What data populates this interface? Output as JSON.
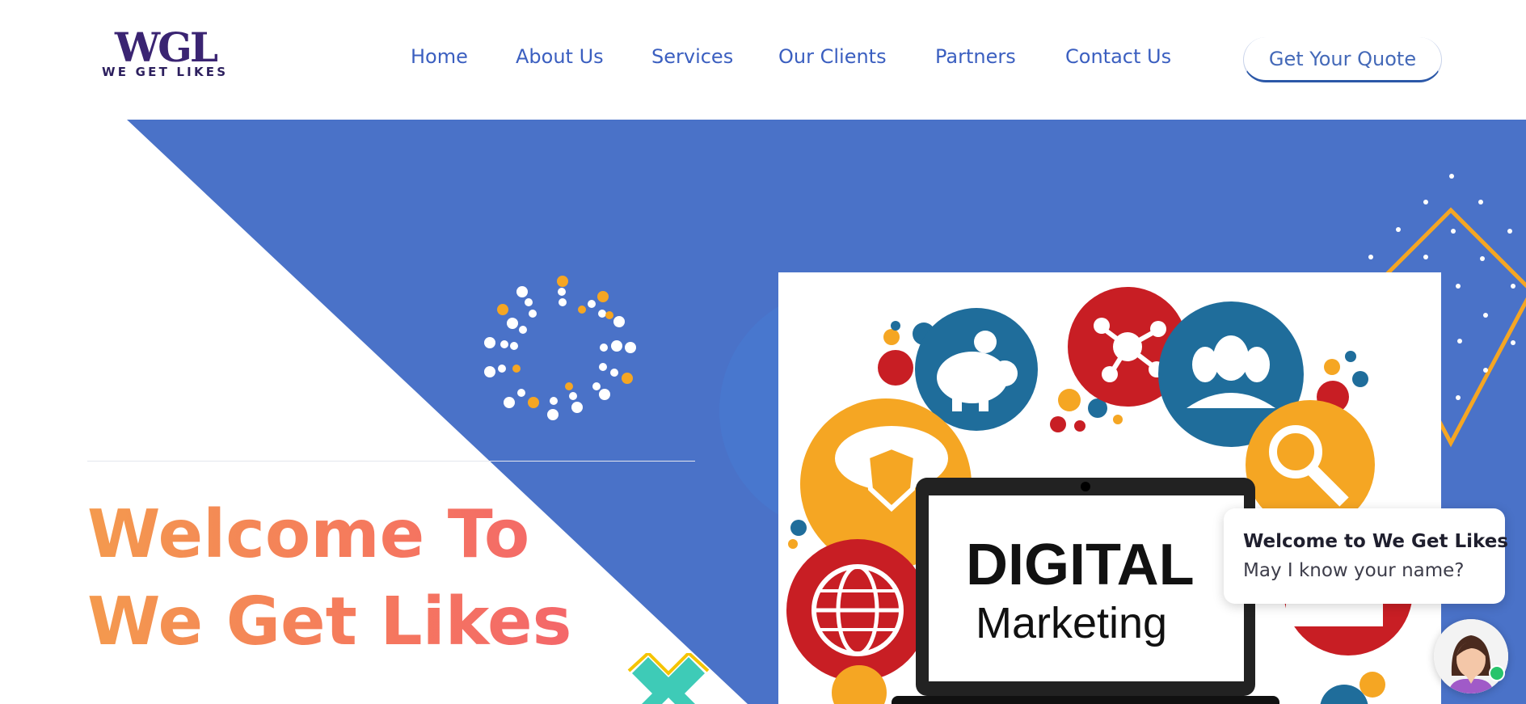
{
  "brand": {
    "logo_mark": "WGL",
    "logo_tagline": "WE GET LIKES",
    "colors": {
      "primary": "#3a2472",
      "accent_blue": "#4a72c8",
      "link": "#3b5fc0"
    }
  },
  "nav": {
    "items": [
      {
        "label": "Home"
      },
      {
        "label": "About Us"
      },
      {
        "label": "Services"
      },
      {
        "label": "Our Clients"
      },
      {
        "label": "Partners"
      },
      {
        "label": "Contact Us"
      }
    ],
    "cta_label": "Get Your Quote"
  },
  "hero": {
    "title_line1": "Welcome To",
    "title_line2": "We Get Likes",
    "gradient_colors": [
      "#f49a4e",
      "#f4676a"
    ],
    "background_color": "#4a72c8"
  },
  "feature_image": {
    "heading": "DIGITAL",
    "subheading": "Marketing",
    "icons": [
      "piggy-bank-icon",
      "network-icon",
      "people-icon",
      "cloud-shield-icon",
      "magnifier-icon",
      "globe-icon",
      "laptop-icon"
    ]
  },
  "chat": {
    "title": "Welcome to We Get Likes",
    "message": "May I know your name?",
    "status_color": "#27c46b"
  }
}
